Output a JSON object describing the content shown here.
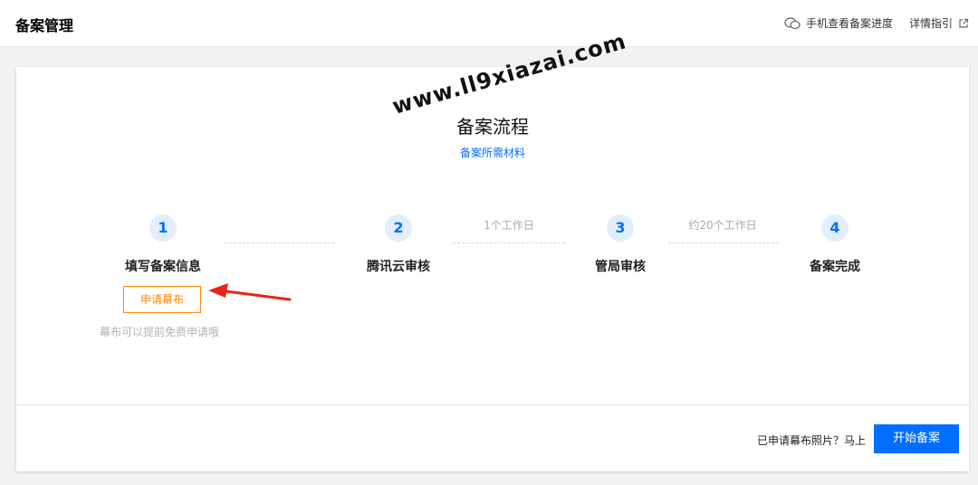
{
  "header": {
    "title": "备案管理",
    "mobile_progress_label": "手机查看备案进度",
    "guide_label": "详情指引"
  },
  "flow": {
    "title": "备案流程",
    "materials_link": "备案所需材料",
    "steps": [
      {
        "num": "1",
        "label": "填写备案信息"
      },
      {
        "num": "2",
        "label": "腾讯云审核"
      },
      {
        "num": "3",
        "label": "管局审核"
      },
      {
        "num": "4",
        "label": "备案完成"
      }
    ],
    "durations": [
      "1个工作日",
      "约20个工作日"
    ]
  },
  "curtain": {
    "apply_button": "申请幕布",
    "hint": "幕布可以提前免费申请哦"
  },
  "footer": {
    "prompt": "已申请幕布照片？马上",
    "start_button": "开始备案"
  },
  "watermark": "www.ll9xiazai.com",
  "colors": {
    "accent": "#006eff",
    "orange": "#ff8a00",
    "annotation_arrow": "#e8231b"
  }
}
